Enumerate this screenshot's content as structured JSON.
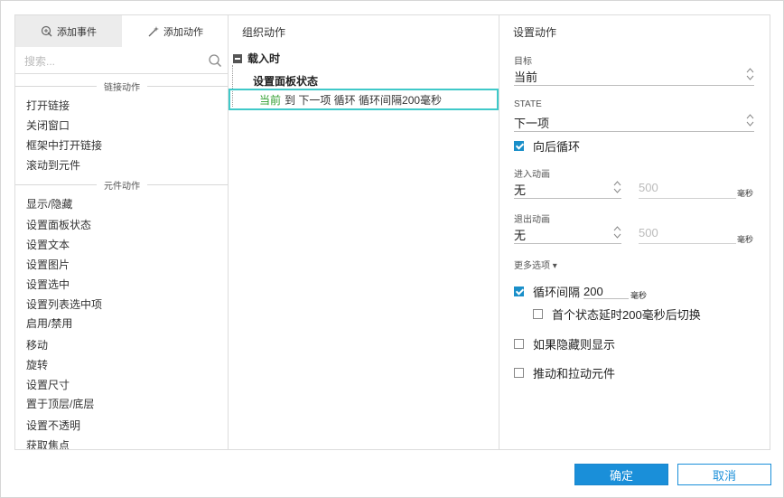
{
  "left": {
    "tabs": [
      {
        "label": "添加事件",
        "icon": "add-event-icon"
      },
      {
        "label": "添加动作",
        "icon": "add-action-icon"
      }
    ],
    "search_placeholder": "搜索...",
    "sections": [
      {
        "title": "链接动作",
        "items": [
          "打开链接",
          "关闭窗口",
          "框架中打开链接",
          "滚动到元件"
        ]
      },
      {
        "title": "元件动作",
        "items": [
          "显示/隐藏",
          "设置面板状态",
          "设置文本",
          "设置图片",
          "设置选中",
          "设置列表选中项",
          "启用/禁用",
          "移动",
          "旋转",
          "设置尺寸",
          "置于顶层/底层",
          "设置不透明",
          "获取焦点"
        ]
      }
    ]
  },
  "mid": {
    "title": "组织动作",
    "event": "载入时",
    "case": "设置面板状态",
    "action_target": "当前",
    "action_text": "到 下一项 循环 循环间隔200毫秒"
  },
  "right": {
    "title": "设置动作",
    "target_label": "目标",
    "target_value": "当前",
    "state_label": "STATE",
    "state_value": "下一项",
    "wrap_label": "向后循环",
    "wrap_checked": true,
    "enter_label": "进入动画",
    "enter_value": "无",
    "enter_duration": "500",
    "exit_label": "退出动画",
    "exit_value": "无",
    "exit_duration": "500",
    "unit_ms": "毫秒",
    "more_label": "更多选项 ▾",
    "loop_label": "循环间隔",
    "loop_value": "200",
    "loop_checked": true,
    "first_delay_label": "首个状态延时200毫秒后切换",
    "first_delay_checked": false,
    "show_if_hidden_label": "如果隐藏则显示",
    "show_if_hidden_checked": false,
    "push_label": "推动和拉动元件",
    "push_checked": false
  },
  "buttons": {
    "ok": "确定",
    "cancel": "取消"
  },
  "colors": {
    "accent": "#1a8fd9",
    "selection": "#3fc9c9",
    "target_green": "#2f9e2f"
  }
}
